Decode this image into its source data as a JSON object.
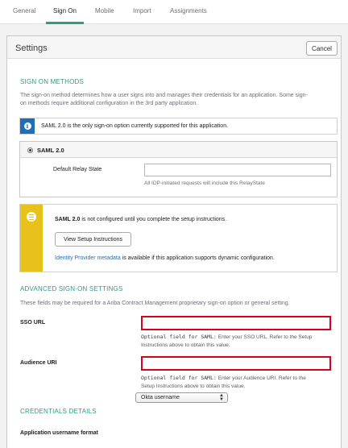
{
  "tabs": {
    "general": "General",
    "sign_on": "Sign On",
    "mobile": "Mobile",
    "import": "Import",
    "assignments": "Assignments"
  },
  "panel": {
    "title": "Settings",
    "cancel_label": "Cancel"
  },
  "sign_on_methods": {
    "heading": "SIGN ON METHODS",
    "description_line1": "The sign-on method determines how a user signs into and manages their credentials for an application. Some sign-",
    "description_line2": "on methods require additional configuration in the 3rd party application.",
    "info_text": "SAML 2.0 is the only sign-on option currently supported for this application.",
    "option_label": "SAML 2.0",
    "relay_state_label": "Default Relay State",
    "relay_state_value": "",
    "relay_state_hint": "All IDP-initiated requests will include this RelayState"
  },
  "setup_notice": {
    "bold_text": "SAML 2.0",
    "text": " is not configured until you complete the setup instructions.",
    "button_label": "View Setup Instructions",
    "metadata_link": "Identity Provider metadata",
    "metadata_text": " is available if this application supports dynamic configuration."
  },
  "advanced": {
    "heading": "ADVANCED SIGN-ON SETTINGS",
    "description": "These fields may be required for a Ariba Contract Management proprietary sign-on option or general setting.",
    "sso_url_label": "SSO URL",
    "sso_url_value": "",
    "sso_hint_mono": "Optional field for SAML:",
    "sso_hint_line1": " Enter your SSO URL. Refer to the Setup",
    "sso_hint_line2": "Instructions above to obtain this value.",
    "audience_label": "Audience URI",
    "audience_value": "",
    "audience_hint_mono": "Optional field for SAML:",
    "audience_hint_line1": " Enter your Audience URI. Refer to the",
    "audience_hint_line2": "Setup Instructions above to obtain this value."
  },
  "credentials": {
    "heading": "CREDENTIALS DETAILS",
    "username_format_label": "Application username format",
    "username_format_value": "Okta username"
  },
  "colors": {
    "accent": "#2f9b85",
    "info_blue": "#1e6fb8",
    "warning_yellow": "#e8c21a",
    "highlight_red": "#d9001b"
  },
  "icons": {
    "info": "info-icon",
    "warning": "list-icon",
    "select_arrows": "chevron-up-down-icon"
  }
}
